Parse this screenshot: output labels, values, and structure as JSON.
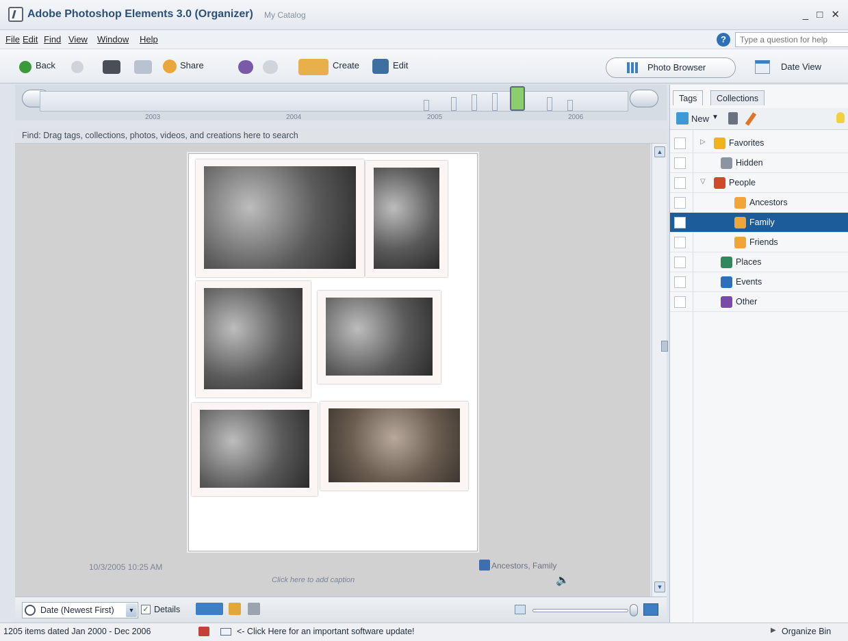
{
  "title_bar": {
    "app_title": "Adobe Photoshop Elements 3.0 (Organizer)",
    "catalog": "My Catalog",
    "controls": "_ □ ✕"
  },
  "menu": {
    "items": [
      "File",
      "Edit",
      "Find",
      "View",
      "Window",
      "Help"
    ],
    "help_placeholder": "Type a question for help"
  },
  "toolbar": {
    "back": "Back",
    "share": "Share",
    "create": "Create",
    "edit": "Edit",
    "photo_browser": "Photo Browser",
    "date_view": "Date View"
  },
  "timeline": {
    "years": [
      "2003",
      "2004",
      "2005",
      "2006"
    ]
  },
  "find_bar": {
    "text": "Find: Drag tags, collections, photos, videos, and creations here to search"
  },
  "photo": {
    "date": "10/3/2005 10:25 AM",
    "tags": "Ancestors, Family",
    "caption_placeholder": "Click here to add caption"
  },
  "bottom_bar": {
    "sort": "Date (Newest First)",
    "details": "Details",
    "details_checked": true
  },
  "status_bar": {
    "items_text": "1205 items dated Jan 2000 - Dec 2006",
    "update_text": "<- Click Here for an important software update!",
    "organize_bin": "Organize Bin"
  },
  "right_panel": {
    "tabs": [
      "Tags",
      "Collections"
    ],
    "new_label": "New",
    "tags": [
      {
        "label": "Favorites",
        "icon": "star-icon",
        "color": "#f2b21e"
      },
      {
        "label": "Hidden",
        "icon": "hidden-icon",
        "color": "#8a94a2"
      },
      {
        "label": "People",
        "icon": "people-icon",
        "color": "#d04a2a"
      },
      {
        "label": "Ancestors",
        "icon": "tag-icon",
        "color": "#f0a43a"
      },
      {
        "label": "Family",
        "icon": "tag-icon",
        "color": "#f0a43a",
        "selected": true
      },
      {
        "label": "Friends",
        "icon": "tag-icon",
        "color": "#f0a43a"
      },
      {
        "label": "Places",
        "icon": "globe-icon",
        "color": "#2e8a5a"
      },
      {
        "label": "Events",
        "icon": "events-icon",
        "color": "#2d6fb8"
      },
      {
        "label": "Other",
        "icon": "other-icon",
        "color": "#7a4aa8"
      }
    ]
  }
}
